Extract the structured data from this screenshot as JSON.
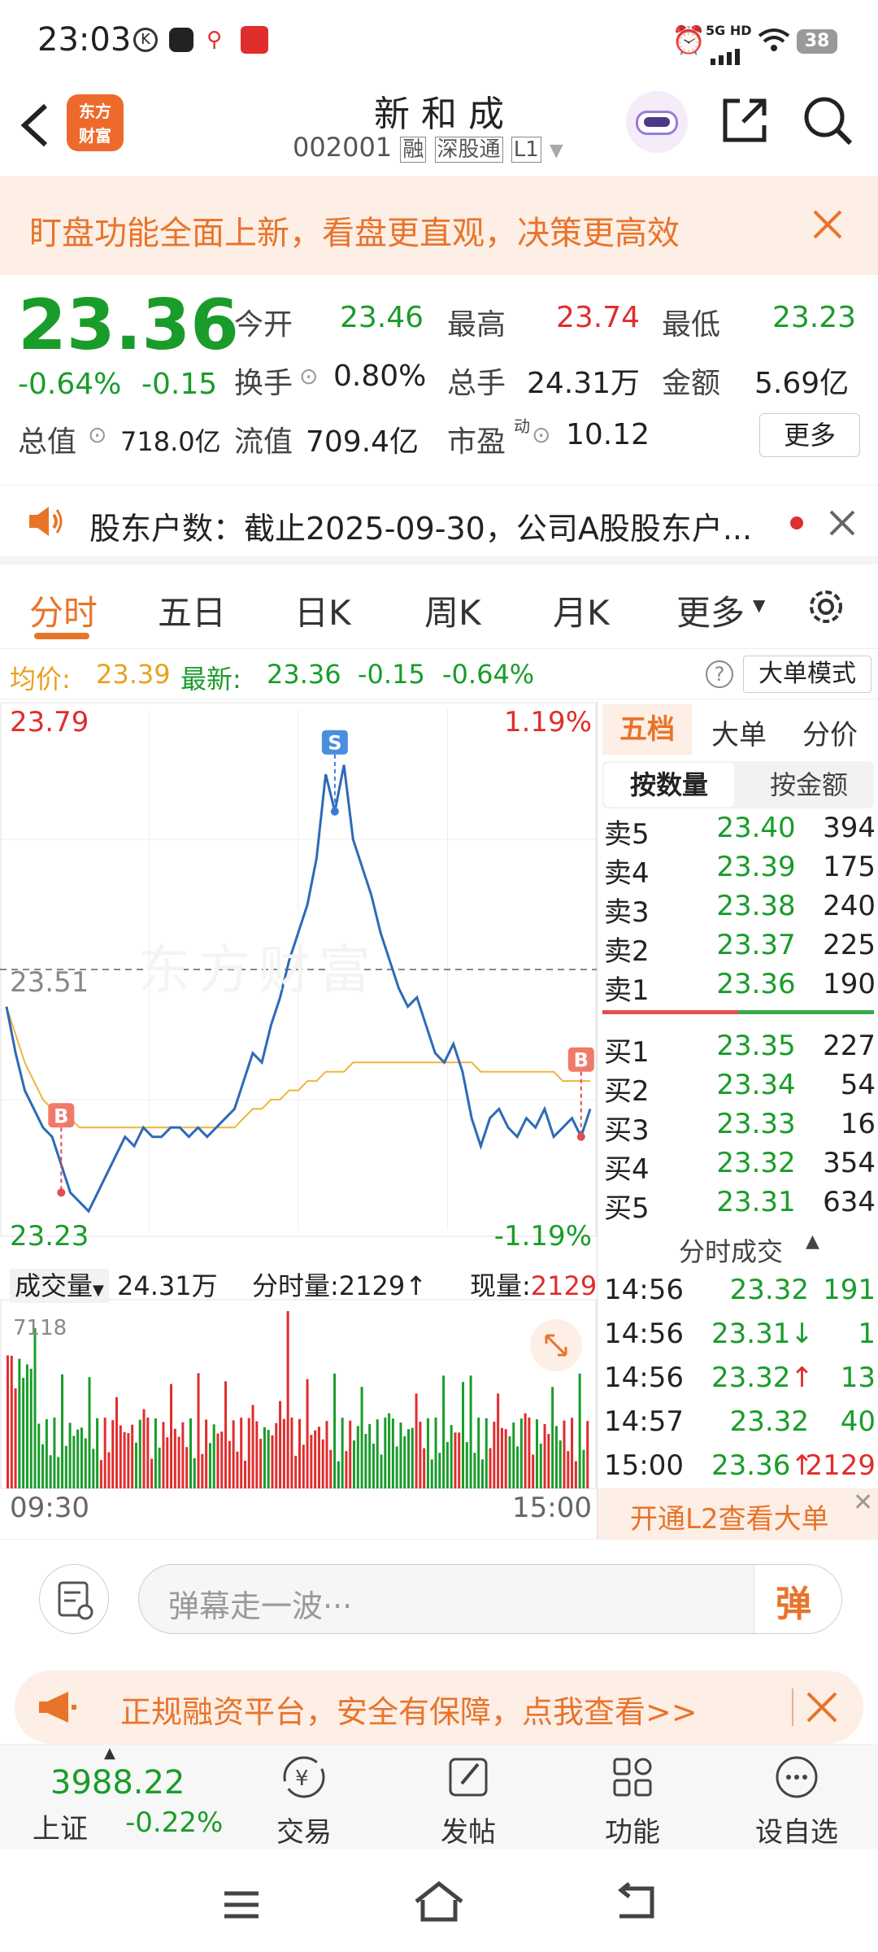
{
  "status": {
    "time": "23:03",
    "network": "5G HD",
    "battery": "38"
  },
  "header": {
    "title": "新 和 成",
    "code": "002001",
    "tag1": "融",
    "tag2": "深股通",
    "tag3": "L1",
    "logo_line1": "东方",
    "logo_line2": "财富"
  },
  "notice": {
    "text": "盯盘功能全面上新，看盘更直观，决策更高效"
  },
  "quote": {
    "price": "23.36",
    "change_pct": "-0.64%",
    "change": "-0.15",
    "open_label": "今开",
    "open": "23.46",
    "high_label": "最高",
    "high": "23.74",
    "low_label": "最低",
    "low": "23.23",
    "turnover_label": "换手",
    "turnover": "0.80%",
    "volume_label": "总手",
    "volume": "24.31万",
    "amount_label": "金额",
    "amount": "5.69亿",
    "mktcap_label": "总值",
    "mktcap": "718.0亿",
    "float_label": "流值",
    "float": "709.4亿",
    "pe_label": "市盈",
    "pe_sup": "动",
    "pe": "10.12",
    "more": "更多"
  },
  "news": {
    "text": "股东户数：截止2025-09-30，公司A股股东户..."
  },
  "tabs": [
    "分时",
    "五日",
    "日K",
    "周K",
    "月K",
    "更多"
  ],
  "info": {
    "avg_label": "均价:",
    "avg": "23.39",
    "last_label": "最新:",
    "last": "23.36",
    "chg": "-0.15",
    "pct": "-0.64%",
    "mode": "大单模式"
  },
  "chart_data": {
    "type": "line",
    "title": "分时",
    "x_start": "09:30",
    "x_end": "15:00",
    "ylim": [
      23.23,
      23.79
    ],
    "y_top": "23.79",
    "y_mid": "23.51",
    "y_bottom": "23.23",
    "pct_top": "1.19%",
    "pct_bottom": "-1.19%",
    "watermark": "东方财富",
    "price": [
      23.47,
      23.42,
      23.38,
      23.36,
      23.34,
      23.33,
      23.3,
      23.27,
      23.26,
      23.25,
      23.27,
      23.29,
      23.31,
      23.33,
      23.32,
      23.34,
      23.33,
      23.33,
      23.34,
      23.34,
      23.33,
      23.34,
      23.33,
      23.34,
      23.35,
      23.36,
      23.39,
      23.42,
      23.41,
      23.45,
      23.48,
      23.52,
      23.55,
      23.58,
      23.63,
      23.72,
      23.68,
      23.73,
      23.65,
      23.62,
      23.59,
      23.55,
      23.52,
      23.49,
      23.47,
      23.48,
      23.45,
      23.42,
      23.41,
      23.43,
      23.4,
      23.35,
      23.32,
      23.35,
      23.36,
      23.34,
      23.33,
      23.35,
      23.34,
      23.36,
      23.33,
      23.34,
      23.35,
      23.33,
      23.36
    ],
    "avg": [
      23.47,
      23.44,
      23.41,
      23.39,
      23.37,
      23.36,
      23.35,
      23.35,
      23.34,
      23.34,
      23.34,
      23.34,
      23.34,
      23.34,
      23.34,
      23.34,
      23.34,
      23.34,
      23.34,
      23.34,
      23.34,
      23.34,
      23.34,
      23.34,
      23.34,
      23.34,
      23.35,
      23.36,
      23.36,
      23.37,
      23.37,
      23.38,
      23.38,
      23.39,
      23.39,
      23.4,
      23.4,
      23.4,
      23.41,
      23.41,
      23.41,
      23.41,
      23.41,
      23.41,
      23.41,
      23.41,
      23.41,
      23.41,
      23.41,
      23.41,
      23.41,
      23.41,
      23.4,
      23.4,
      23.4,
      23.4,
      23.4,
      23.4,
      23.4,
      23.4,
      23.4,
      23.39,
      23.39,
      23.39,
      23.39
    ],
    "markers": [
      {
        "label": "B",
        "x": 6,
        "y": 23.27
      },
      {
        "label": "S",
        "x": 36,
        "y": 23.68
      },
      {
        "label": "B",
        "x": 63,
        "y": 23.33
      }
    ],
    "volume_label": "成交量",
    "volume_total": "24.31万",
    "tick_vol_label": "分时量:",
    "tick_vol": "2129",
    "cur_vol_label": "现量:",
    "cur_vol": "2129",
    "vol_max": "7118"
  },
  "book": {
    "tabs": [
      "五档",
      "大单",
      "分价"
    ],
    "subtabs": [
      "按数量",
      "按金额"
    ],
    "asks": [
      {
        "n": "卖5",
        "p": "23.40",
        "v": "394"
      },
      {
        "n": "卖4",
        "p": "23.39",
        "v": "175"
      },
      {
        "n": "卖3",
        "p": "23.38",
        "v": "240"
      },
      {
        "n": "卖2",
        "p": "23.37",
        "v": "225"
      },
      {
        "n": "卖1",
        "p": "23.36",
        "v": "190"
      }
    ],
    "bids": [
      {
        "n": "买1",
        "p": "23.35",
        "v": "227"
      },
      {
        "n": "买2",
        "p": "23.34",
        "v": "54"
      },
      {
        "n": "买3",
        "p": "23.33",
        "v": "16"
      },
      {
        "n": "买4",
        "p": "23.32",
        "v": "354"
      },
      {
        "n": "买5",
        "p": "23.31",
        "v": "634"
      }
    ],
    "ticks_title": "分时成交",
    "ticks": [
      {
        "t": "14:56",
        "p": "23.32",
        "a": "",
        "v": "191"
      },
      {
        "t": "14:56",
        "p": "23.31",
        "a": "↓",
        "v": "1"
      },
      {
        "t": "14:56",
        "p": "23.32",
        "a": "↑",
        "v": "13"
      },
      {
        "t": "14:57",
        "p": "23.32",
        "a": "",
        "v": "40"
      },
      {
        "t": "15:00",
        "p": "23.36",
        "a": "↑",
        "v": "2129"
      }
    ],
    "l2": "开通L2查看大单"
  },
  "danmu": {
    "placeholder": "弹幕走一波···",
    "btn": "弹"
  },
  "promo": {
    "text": "正规融资平台，安全有保障，点我查看>>"
  },
  "bottomnav": {
    "index_value": "3988.22",
    "index_name": "上证",
    "index_change": "-0.22%",
    "items": [
      "交易",
      "发帖",
      "功能",
      "设自选"
    ]
  },
  "colors": {
    "up": "#e02d2d",
    "down": "#1a9c2a",
    "accent": "#e8742a",
    "price_line": "#2d6ab7",
    "avg_line": "#f0b43c"
  }
}
